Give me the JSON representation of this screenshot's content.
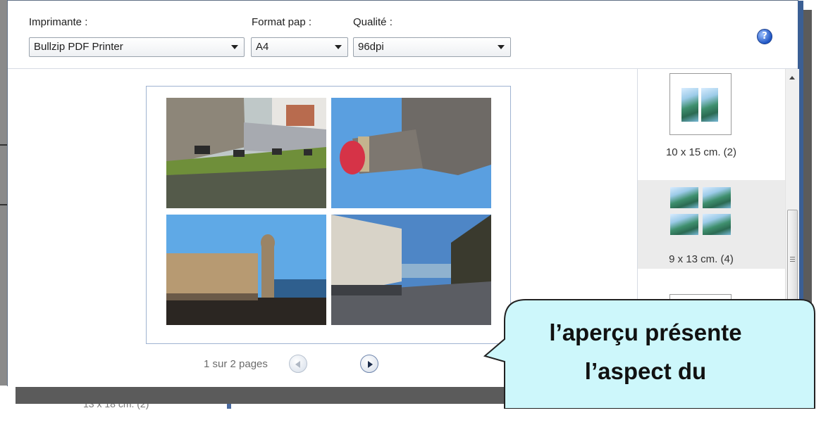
{
  "toolbar": {
    "printer": {
      "label": "Imprimante :",
      "value": "Bullzip PDF Printer"
    },
    "paper_format": {
      "label": "Format pap :",
      "value": "A4"
    },
    "quality": {
      "label": "Qualité :",
      "value": "96dpi"
    },
    "help_icon": "help-icon",
    "help_symbol": "?"
  },
  "preview": {
    "photos": [
      {
        "name": "photo-castle-walls-animals"
      },
      {
        "name": "photo-stone-pillar-red-cap"
      },
      {
        "name": "photo-harbor-church-tower"
      },
      {
        "name": "photo-seaside-promenade"
      }
    ],
    "pager": {
      "label": "1 sur 2 pages",
      "prev_icon": "arrow-left-icon",
      "next_icon": "arrow-right-icon"
    }
  },
  "layouts": [
    {
      "label": "10 x 15 cm. (2)",
      "selected": false
    },
    {
      "label": "9 x 13 cm. (4)",
      "selected": true
    },
    {
      "label": "",
      "selected": false
    }
  ],
  "callout": {
    "line1": "l’aperçu  présente",
    "line2": "l’aspect  du",
    "fill": "#cdf7fb"
  },
  "background": {
    "bottom_label": "13 x 18 cm. (2)"
  }
}
